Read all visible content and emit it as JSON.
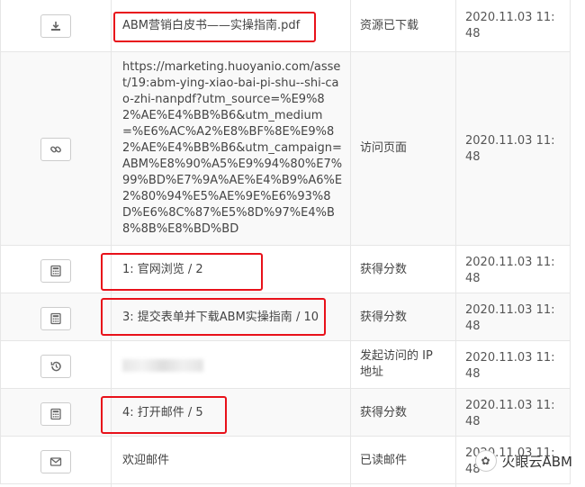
{
  "rows": [
    {
      "icon": "download-icon",
      "description": "ABM营销白皮书——实操指南.pdf",
      "type": "资源已下载",
      "time": "2020.11.03 11:48"
    },
    {
      "icon": "link-icon",
      "description": "https://marketing.huoyanio.com/asset/19:abm-ying-xiao-bai-pi-shu--shi-cao-zhi-nanpdf?utm_source=%E9%82%AE%E4%BB%B6&utm_medium=%E6%AC%A2%E8%BF%8E%E9%82%AE%E4%BB%B6&utm_campaign=ABM%E8%90%A5%E9%94%80%E7%99%BD%E7%9A%AE%E4%B9%A6%E2%80%94%E5%AE%9E%E6%93%8D%E6%8C%87%E5%8D%97%E4%B8%8B%E8%BD%BD",
      "type": "访问页面",
      "time": "2020.11.03 11:48"
    },
    {
      "icon": "calculator-icon",
      "description": "1: 官网浏览 / 2",
      "type": "获得分数",
      "time": "2020.11.03 11:48"
    },
    {
      "icon": "calculator-icon",
      "description": "3: 提交表单并下载ABM实操指南 / 10",
      "type": "获得分数",
      "time": "2020.11.03 11:48"
    },
    {
      "icon": "history-icon",
      "description": "",
      "type": "发起访问的 IP 地址",
      "time": "2020.11.03 11:48"
    },
    {
      "icon": "calculator-icon",
      "description": "4: 打开邮件 / 5",
      "type": "获得分数",
      "time": "2020.11.03 11:48"
    },
    {
      "icon": "envelope-icon",
      "description": "欢迎邮件",
      "type": "已读邮件",
      "time": "2020.11.03 11:48"
    }
  ],
  "watermark": {
    "text": "火眼云ABM"
  },
  "colors": {
    "highlight": "#e8111a",
    "border": "#e6e6e6",
    "alt_row": "#f9f9f9"
  }
}
